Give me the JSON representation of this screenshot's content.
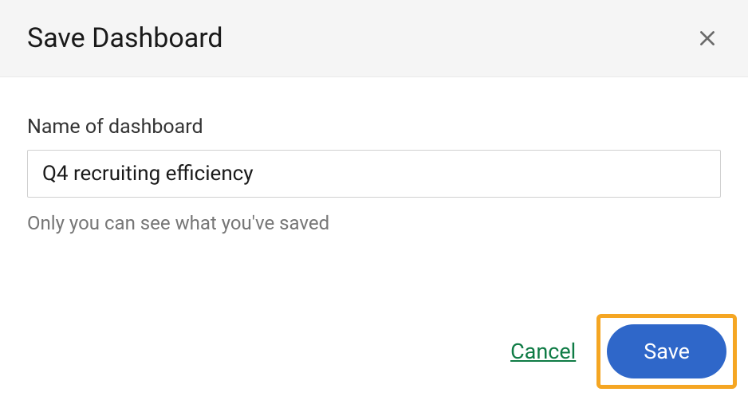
{
  "header": {
    "title": "Save Dashboard"
  },
  "form": {
    "name_label": "Name of dashboard",
    "name_value": "Q4 recruiting efficiency",
    "helper_text": "Only you can see what you've saved"
  },
  "footer": {
    "cancel_label": "Cancel",
    "save_label": "Save"
  }
}
